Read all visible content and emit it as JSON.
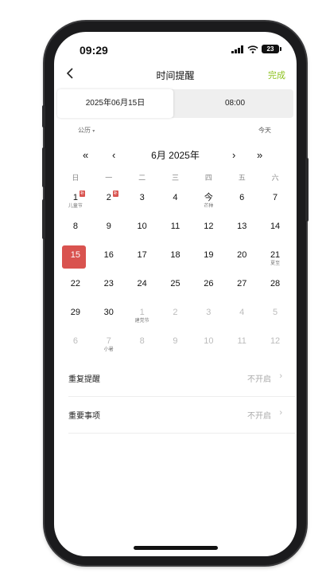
{
  "status_bar": {
    "time": "09:29",
    "battery": "23"
  },
  "nav": {
    "title": "时间提醒",
    "done_label": "完成"
  },
  "segment": {
    "date": "2025年06月15日",
    "time": "08:00"
  },
  "calendar_type": "公历",
  "today_label": "今天",
  "month_nav": {
    "prev_year": "«",
    "prev_month": "‹",
    "title": "6月 2025年",
    "next_month": "›",
    "next_year": "»"
  },
  "weekdays": [
    "日",
    "一",
    "二",
    "三",
    "四",
    "五",
    "六"
  ],
  "days": [
    {
      "num": "1",
      "sub": "儿童节",
      "badge": "补",
      "muted": false
    },
    {
      "num": "2",
      "sub": "",
      "badge": "补",
      "muted": false
    },
    {
      "num": "3",
      "sub": "",
      "badge": "",
      "muted": false
    },
    {
      "num": "4",
      "sub": "",
      "badge": "",
      "muted": false
    },
    {
      "num": "今",
      "sub": "芒种",
      "badge": "",
      "muted": false
    },
    {
      "num": "6",
      "sub": "",
      "badge": "",
      "muted": false
    },
    {
      "num": "7",
      "sub": "",
      "badge": "",
      "muted": false
    },
    {
      "num": "8",
      "sub": "",
      "badge": "",
      "muted": false
    },
    {
      "num": "9",
      "sub": "",
      "badge": "",
      "muted": false
    },
    {
      "num": "10",
      "sub": "",
      "badge": "",
      "muted": false
    },
    {
      "num": "11",
      "sub": "",
      "badge": "",
      "muted": false
    },
    {
      "num": "12",
      "sub": "",
      "badge": "",
      "muted": false
    },
    {
      "num": "13",
      "sub": "",
      "badge": "",
      "muted": false
    },
    {
      "num": "14",
      "sub": "",
      "badge": "",
      "muted": false
    },
    {
      "num": "15",
      "sub": "",
      "badge": "",
      "muted": false,
      "selected": true
    },
    {
      "num": "16",
      "sub": "",
      "badge": "",
      "muted": false
    },
    {
      "num": "17",
      "sub": "",
      "badge": "",
      "muted": false
    },
    {
      "num": "18",
      "sub": "",
      "badge": "",
      "muted": false
    },
    {
      "num": "19",
      "sub": "",
      "badge": "",
      "muted": false
    },
    {
      "num": "20",
      "sub": "",
      "badge": "",
      "muted": false
    },
    {
      "num": "21",
      "sub": "夏至",
      "badge": "",
      "muted": false
    },
    {
      "num": "22",
      "sub": "",
      "badge": "",
      "muted": false
    },
    {
      "num": "23",
      "sub": "",
      "badge": "",
      "muted": false
    },
    {
      "num": "24",
      "sub": "",
      "badge": "",
      "muted": false
    },
    {
      "num": "25",
      "sub": "",
      "badge": "",
      "muted": false
    },
    {
      "num": "26",
      "sub": "",
      "badge": "",
      "muted": false
    },
    {
      "num": "27",
      "sub": "",
      "badge": "",
      "muted": false
    },
    {
      "num": "28",
      "sub": "",
      "badge": "",
      "muted": false
    },
    {
      "num": "29",
      "sub": "",
      "badge": "",
      "muted": false
    },
    {
      "num": "30",
      "sub": "",
      "badge": "",
      "muted": false
    },
    {
      "num": "1",
      "sub": "建党节",
      "badge": "",
      "muted": true
    },
    {
      "num": "2",
      "sub": "",
      "badge": "",
      "muted": true
    },
    {
      "num": "3",
      "sub": "",
      "badge": "",
      "muted": true
    },
    {
      "num": "4",
      "sub": "",
      "badge": "",
      "muted": true
    },
    {
      "num": "5",
      "sub": "",
      "badge": "",
      "muted": true
    },
    {
      "num": "6",
      "sub": "",
      "badge": "",
      "muted": true
    },
    {
      "num": "7",
      "sub": "小暑",
      "badge": "",
      "muted": true
    },
    {
      "num": "8",
      "sub": "",
      "badge": "",
      "muted": true
    },
    {
      "num": "9",
      "sub": "",
      "badge": "",
      "muted": true
    },
    {
      "num": "10",
      "sub": "",
      "badge": "",
      "muted": true
    },
    {
      "num": "11",
      "sub": "",
      "badge": "",
      "muted": true
    },
    {
      "num": "12",
      "sub": "",
      "badge": "",
      "muted": true
    }
  ],
  "settings": [
    {
      "label": "重复提醒",
      "value": "不开启"
    },
    {
      "label": "重要事项",
      "value": "不开启"
    }
  ],
  "colors": {
    "accent": "#8dc21f",
    "selected": "#d9534f"
  }
}
